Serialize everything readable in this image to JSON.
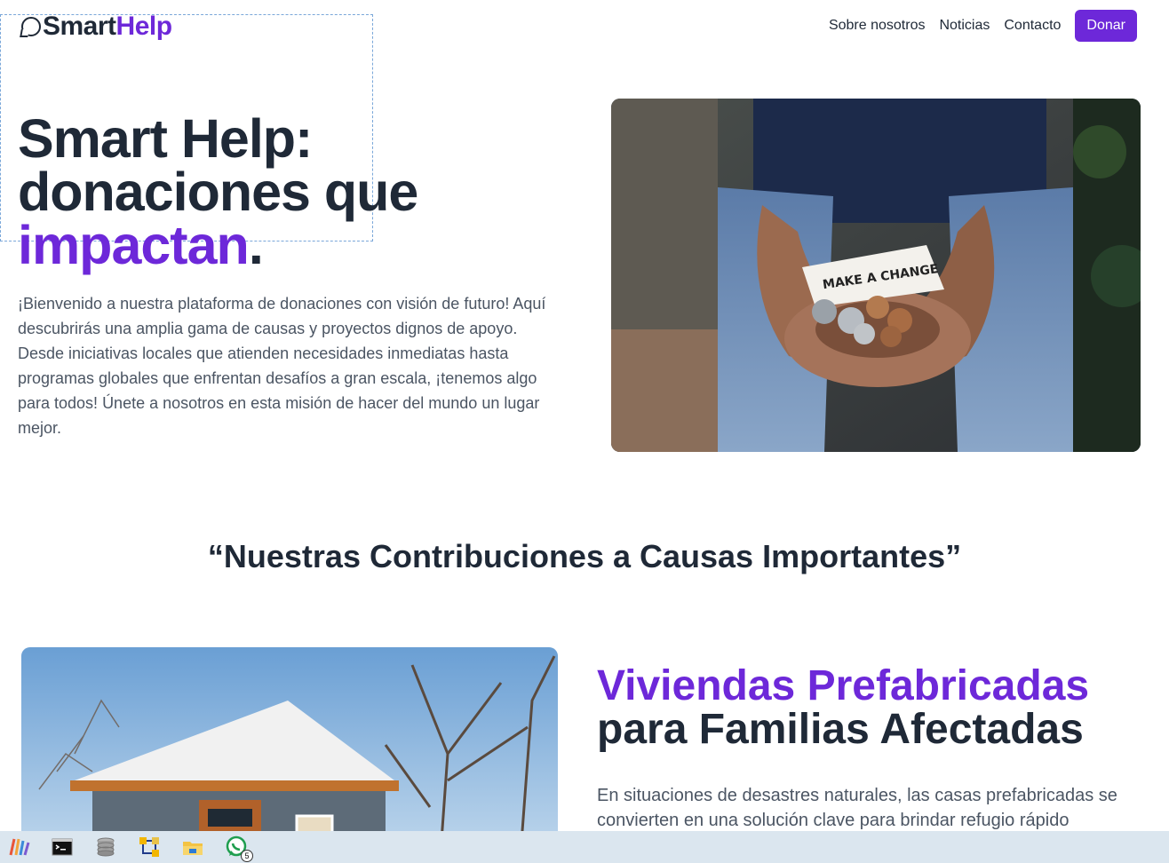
{
  "nav": {
    "logo_part1": "Smart",
    "logo_part2": "Help",
    "links": [
      "Sobre nosotros",
      "Noticias",
      "Contacto"
    ],
    "donate_label": "Donar"
  },
  "hero": {
    "title_line1": "Smart Help:",
    "title_line2": "donaciones que",
    "title_accent": "impactan",
    "title_end": ".",
    "description": "¡Bienvenido a nuestra plataforma de donaciones con visión de futuro! Aquí descubrirás una amplia gama de causas y proyectos dignos de apoyo. Desde iniciativas locales que atienden necesidades inmediatas hasta programas globales que enfrentan desafíos a gran escala, ¡tenemos algo para todos! Únete a nosotros en esta misión de hacer del mundo un lugar mejor.",
    "image_note": "MAKE A CHANGE"
  },
  "contributions": {
    "section_title": "“Nuestras Contribuciones a Causas Importantes”",
    "feature_title_accent": "Viviendas Prefabricadas",
    "feature_title_rest": "para Familias Afectadas",
    "feature_text": "En situaciones de desastres naturales, las casas prefabricadas se convierten en una solución clave para brindar refugio rápido"
  },
  "taskbar": {
    "apps": [
      "app-launcher-icon",
      "terminal-icon",
      "database-icon",
      "network-tool-icon",
      "file-explorer-icon",
      "whatsapp-icon"
    ],
    "whatsapp_badge": "5"
  },
  "colors": {
    "brand": "#6d28d9",
    "text_dark": "#1f2937",
    "text_muted": "#4b5563",
    "taskbar": "#dbe6ef"
  }
}
